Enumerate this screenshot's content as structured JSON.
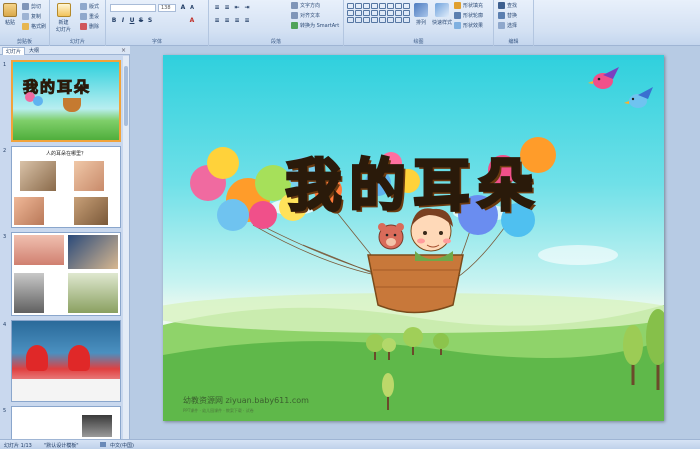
{
  "ribbon": {
    "clipboard": {
      "paste": "粘贴",
      "cut": "剪切",
      "copy": "复制",
      "format_painter": "格式刷",
      "label": "剪贴板"
    },
    "slides": {
      "new_slide": "新建",
      "new_slide2": "幻灯片",
      "layout": "版式",
      "reset": "重设",
      "delete": "删除",
      "label": "幻灯片"
    },
    "font": {
      "font_size": "138",
      "label": "字体"
    },
    "paragraph": {
      "text_direction": "文字方向",
      "align_text": "对齐文本",
      "smartart": "转换为 SmartArt",
      "label": "段落"
    },
    "drawing": {
      "arrange": "排列",
      "quick_styles": "快速样式",
      "shape_fill": "形状填充",
      "shape_outline": "形状轮廓",
      "shape_effects": "形状效果",
      "label": "绘图"
    },
    "editing": {
      "find": "查找",
      "replace": "替换",
      "select": "选择",
      "label": "编辑"
    }
  },
  "panel": {
    "tab_slides": "幻灯片",
    "tab_outline": "大纲",
    "close": "×",
    "thumbnails": [
      {
        "num": "1",
        "title": "我的耳朵"
      },
      {
        "num": "2",
        "title": "人的耳朵在哪里？"
      },
      {
        "num": "3",
        "title": ""
      },
      {
        "num": "4",
        "title": ""
      },
      {
        "num": "5",
        "title": ""
      }
    ]
  },
  "slide": {
    "title": "我的耳朵",
    "watermark": "幼教资源网 ziyuan.baby611.com",
    "watermark_sub": "PPT课件 · 幼儿园课件 · 教案下载 · 试卷"
  },
  "status": {
    "slide_count": "幻灯片 1/13",
    "theme": "\"默认设计模板\"",
    "language": "中文(中国)"
  }
}
